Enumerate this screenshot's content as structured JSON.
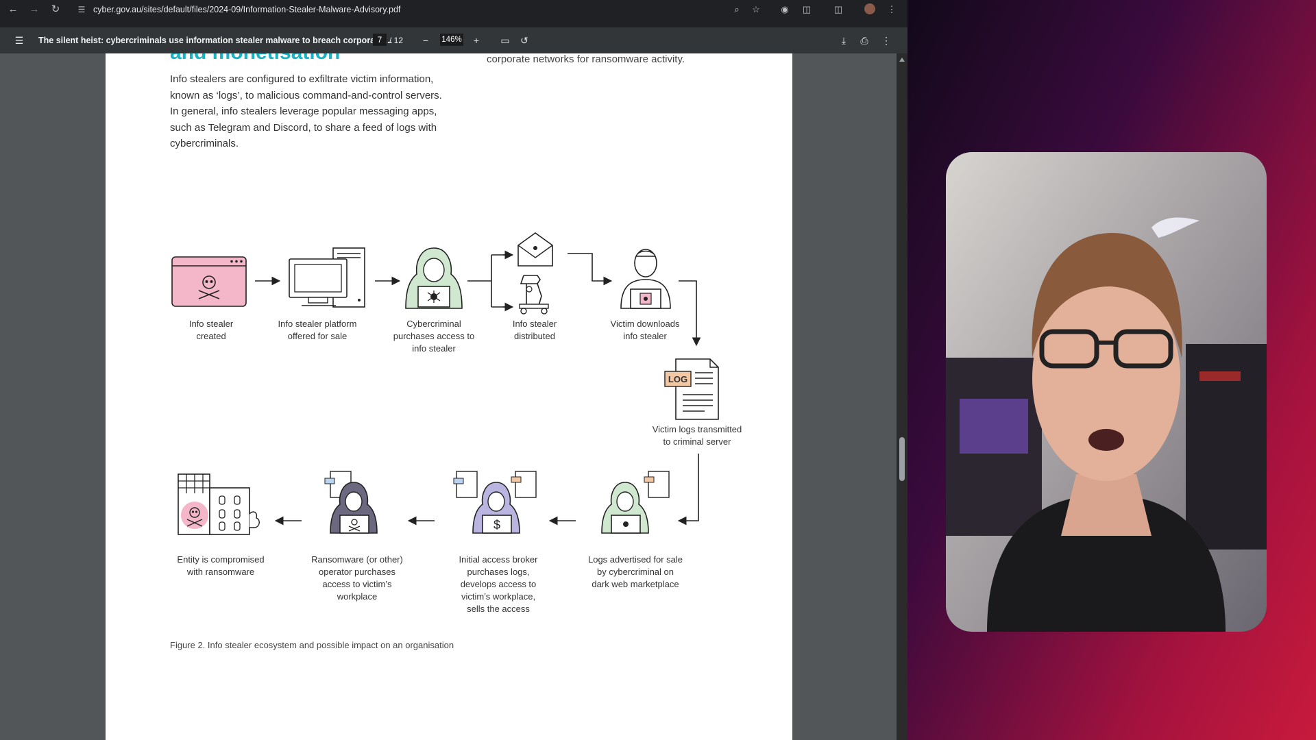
{
  "browser": {
    "url": "cyber.gov.au/sites/default/files/2024-09/Information-Stealer-Malware-Advisory.pdf",
    "icons": [
      "back-icon",
      "forward-icon",
      "reload-icon",
      "site-info-icon",
      "zoom-icon",
      "star-icon",
      "extension-icon",
      "puzzle-icon",
      "sidebar-icon",
      "avatar",
      "more-icon"
    ]
  },
  "viewer": {
    "doc_title": "The silent heist: cybercriminals use information stealer malware to breach corporate ...",
    "page_current": "7",
    "page_total": "/ 12",
    "zoom": "146%",
    "icons": [
      "menu-icon",
      "zoom-out-icon",
      "zoom-in-icon",
      "fit-page-icon",
      "rotate-icon",
      "download-icon",
      "print-icon",
      "more-icon"
    ]
  },
  "pdf": {
    "heading_fragment": "and monetisation",
    "right_fragment": "corporate networks for ransomware activity.",
    "body_text": "Info stealers are configured to exfiltrate victim information, known as ‘logs’, to malicious command-and-control servers. In general, info stealers leverage popular messaging apps, such as Telegram and Discord, to share a feed of logs with cybercriminals.",
    "figure_caption": "Figure 2.  Info stealer ecosystem and possible impact on an organisation",
    "steps": [
      {
        "id": "created",
        "label": "Info stealer\ncreated"
      },
      {
        "id": "platform",
        "label": "Info stealer platform\noffered for sale"
      },
      {
        "id": "purchase",
        "label": "Cybercriminal\npurchases access to\ninfo stealer"
      },
      {
        "id": "distributed",
        "label": "Info stealer\ndistributed"
      },
      {
        "id": "downloads",
        "label": "Victim downloads\ninfo stealer"
      },
      {
        "id": "logs",
        "label": "Victim logs transmitted\nto criminal server"
      },
      {
        "id": "advertised",
        "label": "Logs advertised for sale\nby cybercriminal on\ndark web marketplace"
      },
      {
        "id": "broker",
        "label": "Initial access broker\npurchases logs,\ndevelops access to\nvictim’s workplace,\nsells the access"
      },
      {
        "id": "ransomware",
        "label": "Ransomware (or other)\noperator purchases\naccess to victim’s\nworkplace"
      },
      {
        "id": "compromised",
        "label": "Entity is compromised\nwith ransomware"
      }
    ],
    "log_badge": "LOG",
    "colors": {
      "teal": "#1bb3c4",
      "pink": "#f4b6c9",
      "green": "#cfe8cf",
      "purple": "#b9b4e0",
      "dark_purple": "#6b6880"
    }
  }
}
